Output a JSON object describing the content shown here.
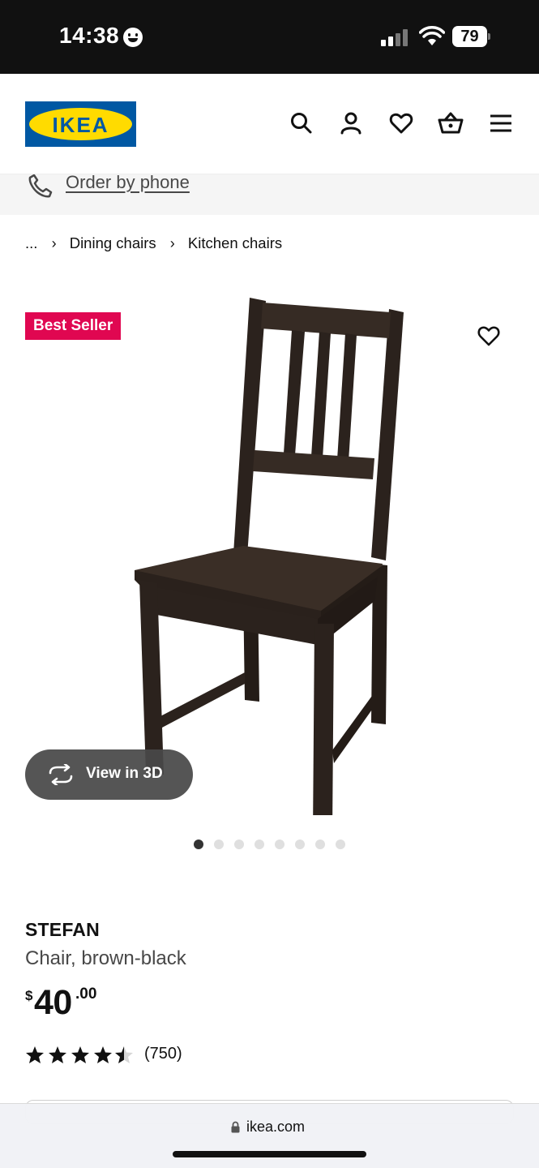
{
  "status_bar": {
    "time": "14:38",
    "battery": "79",
    "icons": [
      "emoji-icon",
      "cellular-signal-icon",
      "wifi-icon",
      "battery-icon"
    ]
  },
  "header": {
    "logo_text": "IKEA",
    "logo_colors": {
      "background": "#0058a3",
      "oval": "#ffdb00"
    },
    "actions": [
      "search-icon",
      "account-icon",
      "favorites-icon",
      "shopping-bag-icon",
      "menu-icon"
    ]
  },
  "phone_banner": {
    "label": "Order by phone",
    "icon": "phone-icon"
  },
  "breadcrumb": {
    "ellipsis": "...",
    "items": [
      {
        "label": "Dining chairs"
      },
      {
        "label": "Kitchen chairs"
      }
    ],
    "separator_icon": "chevron-right-icon"
  },
  "gallery": {
    "badge": "Best Seller",
    "badge_color": "#e00751",
    "view_3d_label": "View in 3D",
    "favorite_icon": "heart-icon",
    "image": "brown-black wooden chair",
    "page_indicator": {
      "total": 8,
      "active_index": 0
    }
  },
  "product": {
    "name": "STEFAN",
    "description": "Chair, brown-black",
    "price": {
      "currency_symbol": "$",
      "integer": "40",
      "decimal": ".00"
    },
    "rating": {
      "stars": 4.5,
      "max": 5,
      "count": "(750)"
    }
  },
  "browser": {
    "url": "ikea.com",
    "lock_icon": "lock-icon"
  }
}
